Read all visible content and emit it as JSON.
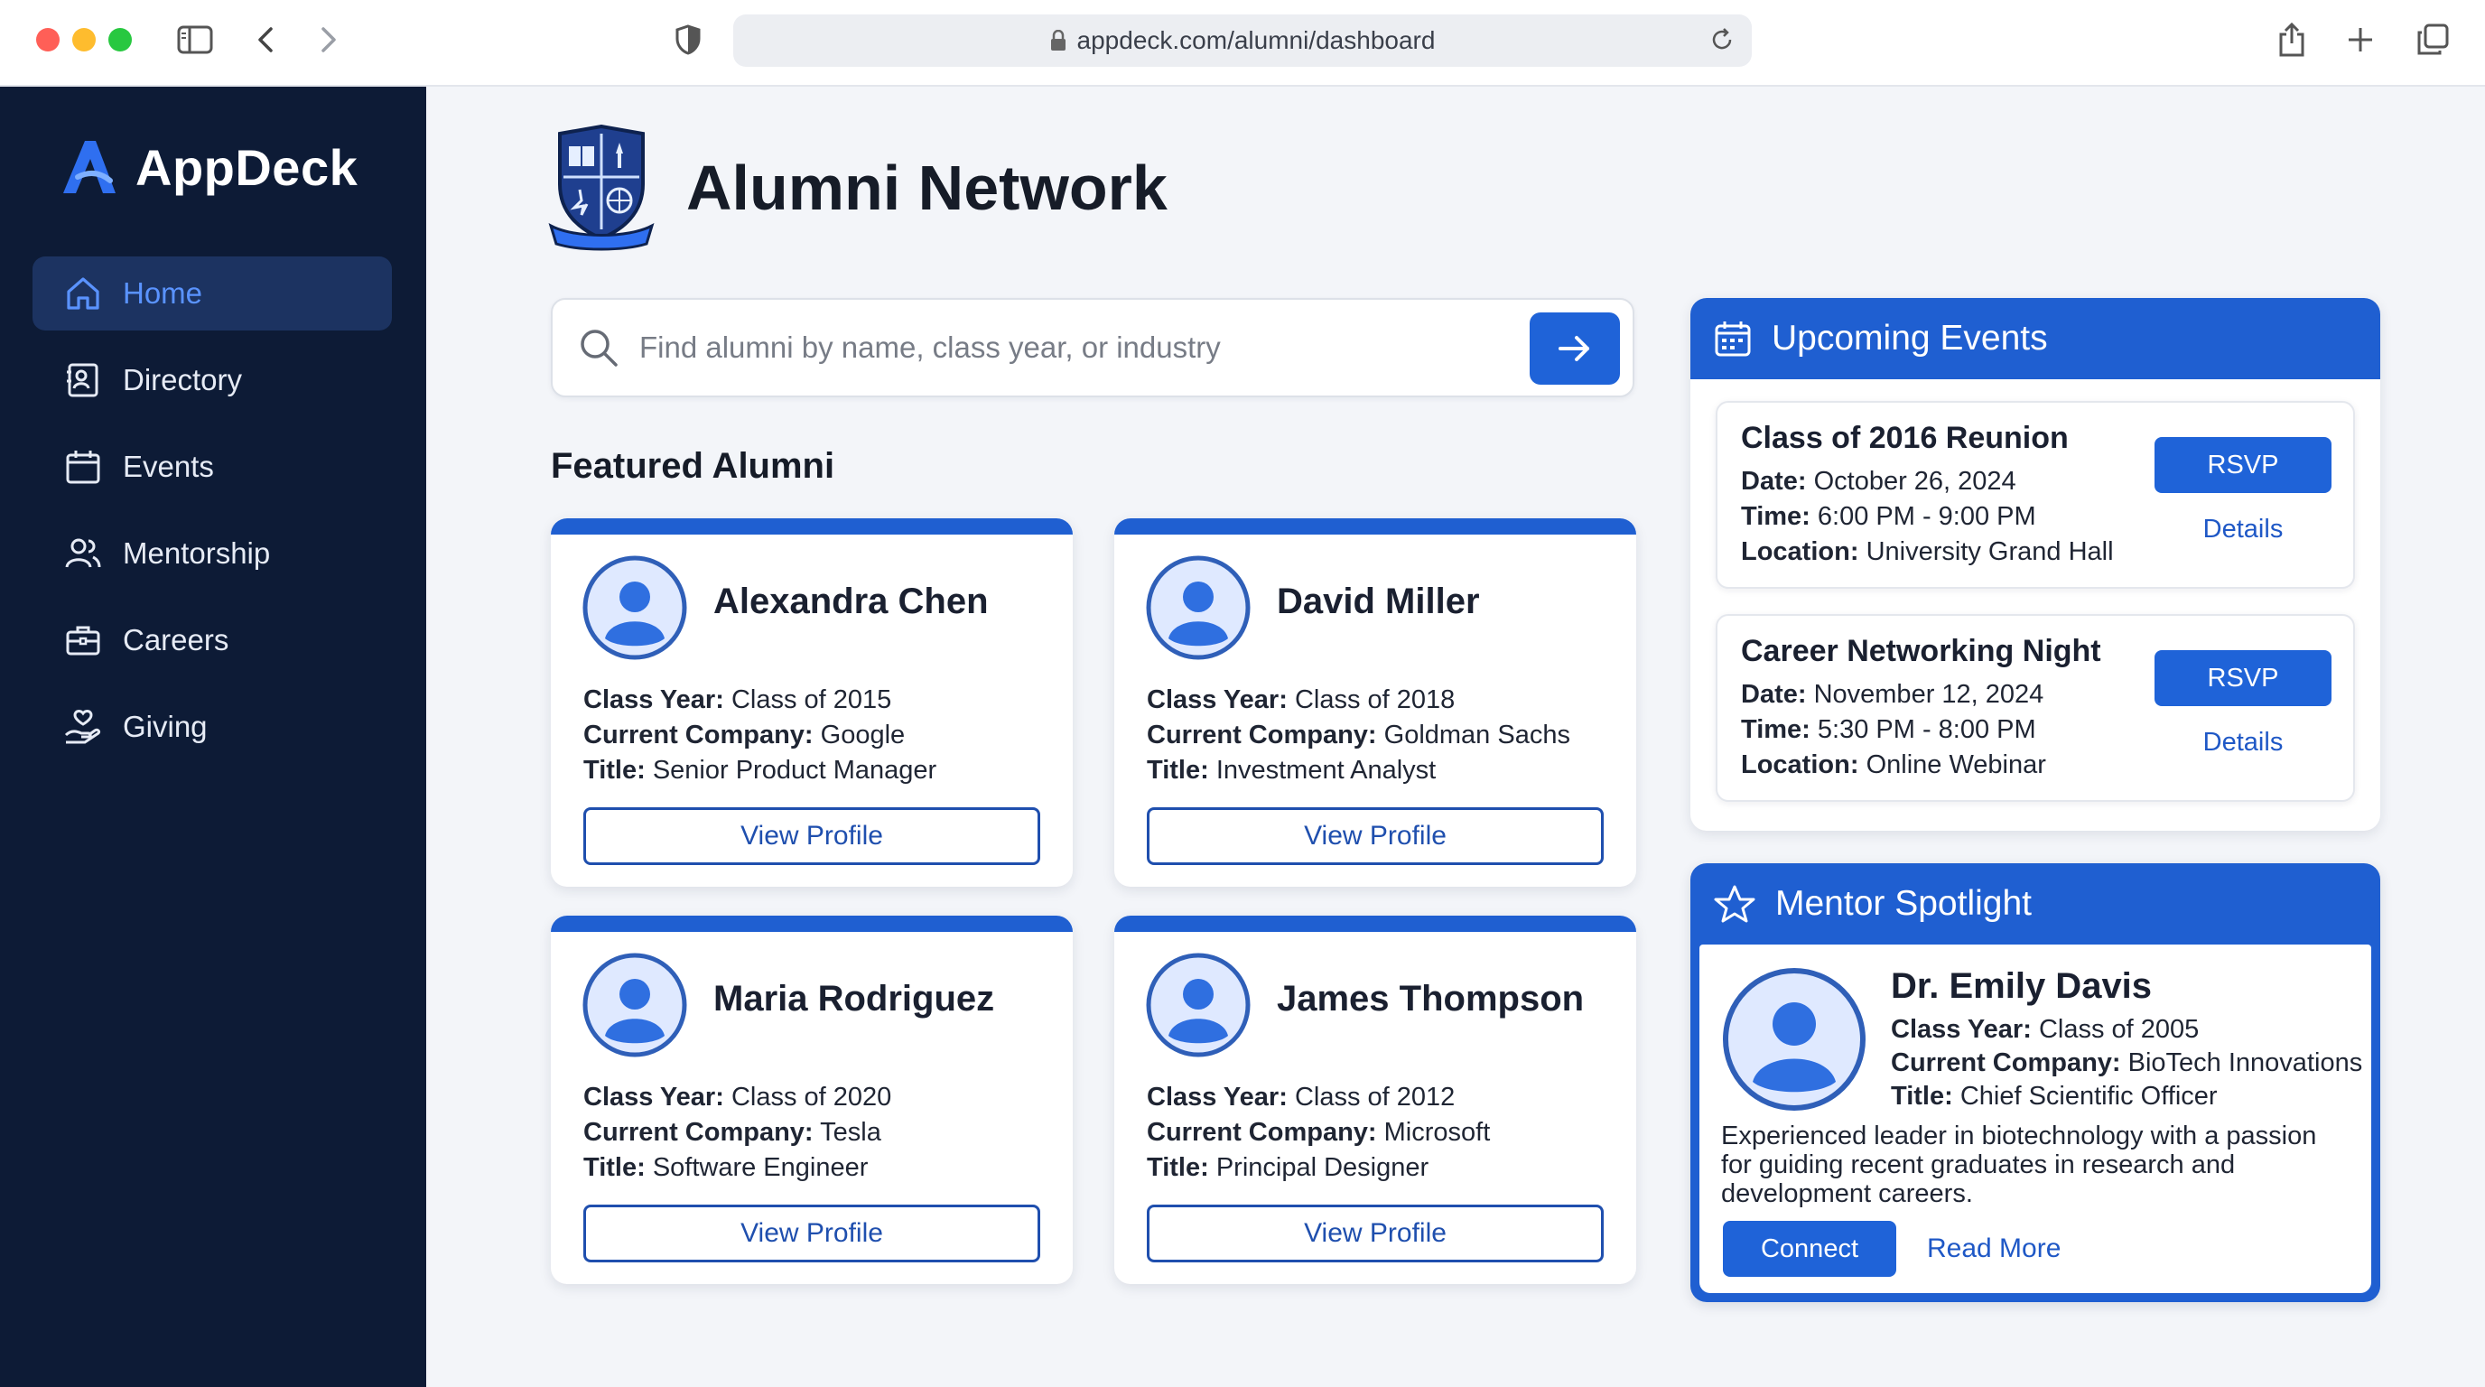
{
  "browser": {
    "url": "appdeck.com/alumni/dashboard"
  },
  "sidebar": {
    "brand": "AppDeck",
    "items": [
      {
        "label": "Home",
        "icon": "home-icon",
        "active": true
      },
      {
        "label": "Directory",
        "icon": "directory-icon"
      },
      {
        "label": "Events",
        "icon": "calendar-icon"
      },
      {
        "label": "Mentorship",
        "icon": "people-icon"
      },
      {
        "label": "Careers",
        "icon": "briefcase-icon"
      },
      {
        "label": "Giving",
        "icon": "giving-hand-icon"
      }
    ]
  },
  "header": {
    "title": "Alumni Network"
  },
  "search": {
    "placeholder": "Find alumni by name, class year, or industry"
  },
  "featured": {
    "title": "Featured Alumni",
    "labels": {
      "class_year": "Class Year:",
      "company": "Current Company:",
      "title": "Title:"
    },
    "button_label": "View Profile",
    "alumni": [
      {
        "name": "Alexandra Chen",
        "class_year": "Class of 2015",
        "company": "Google",
        "title": "Senior Product Manager"
      },
      {
        "name": "David Miller",
        "class_year": "Class of 2018",
        "company": "Goldman Sachs",
        "title": "Investment Analyst"
      },
      {
        "name": "Maria Rodriguez",
        "class_year": "Class of 2020",
        "company": "Tesla",
        "title": "Software Engineer"
      },
      {
        "name": "James Thompson",
        "class_year": "Class of 2012",
        "company": "Microsoft",
        "title": "Principal Designer"
      }
    ]
  },
  "events": {
    "title": "Upcoming Events",
    "labels": {
      "date": "Date:",
      "time": "Time:",
      "location": "Location:"
    },
    "rsvp_label": "RSVP",
    "details_label": "Details",
    "items": [
      {
        "title": "Class of 2016 Reunion",
        "date": "October 26, 2024",
        "time": "6:00 PM - 9:00 PM",
        "location": "University Grand Hall"
      },
      {
        "title": "Career Networking Night",
        "date": "November 12, 2024",
        "time": "5:30 PM - 8:00 PM",
        "location": "Online Webinar"
      }
    ]
  },
  "mentor": {
    "title": "Mentor Spotlight",
    "name": "Dr. Emily Davis",
    "class_year": "Class of 2005",
    "company": "BioTech Innovations",
    "job_title": "Chief Scientific Officer",
    "bio": "Experienced leader in biotechnology with a passion for guiding recent graduates in research and development careers.",
    "connect_label": "Connect",
    "read_more_label": "Read More"
  },
  "colors": {
    "sidebar_bg": "#0d1b36",
    "accent": "#1f5fd1",
    "button": "#1f63d8",
    "active_nav": "#5a93ff"
  }
}
